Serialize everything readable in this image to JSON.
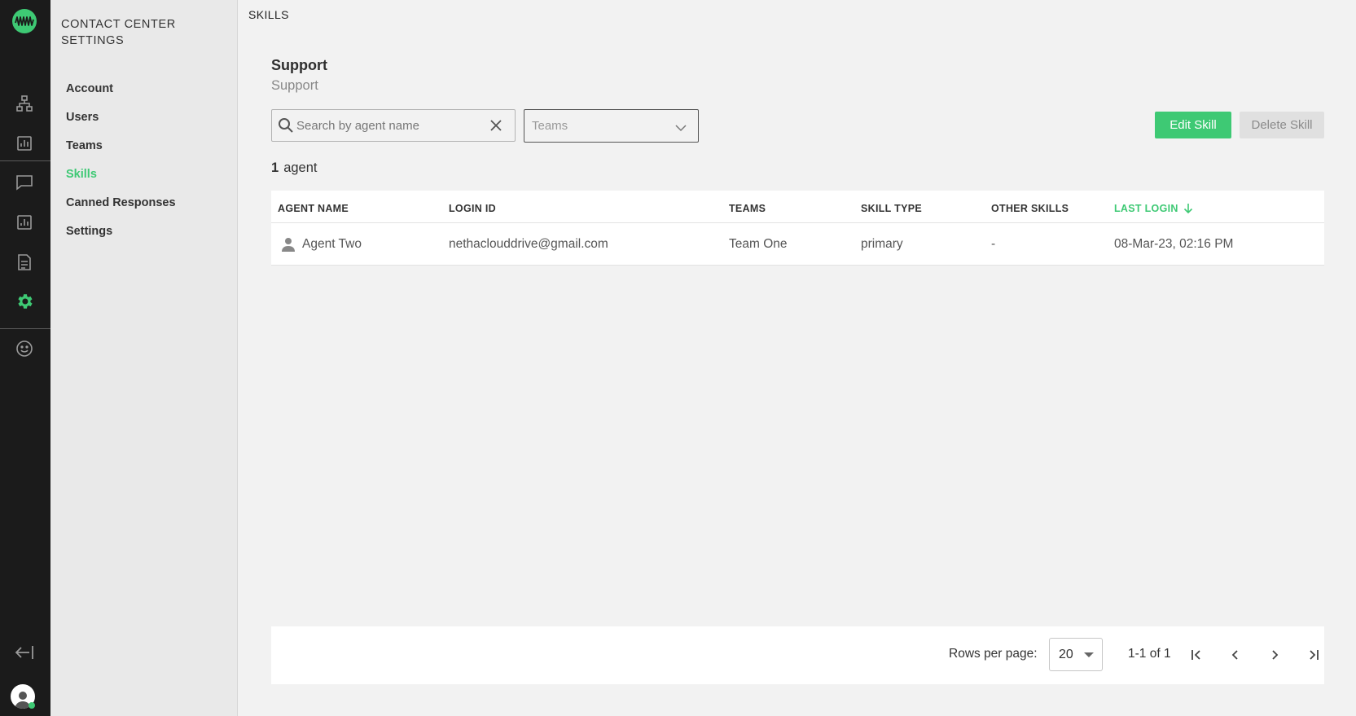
{
  "nav_rail": {
    "icons": [
      "logo-icon",
      "org-chart-icon",
      "analytics-icon",
      "chat-icon",
      "reports-icon",
      "document-icon",
      "settings-icon",
      "smiley-icon",
      "logout-icon",
      "user-avatar-icon"
    ],
    "active": "settings-icon"
  },
  "sidebar": {
    "title": "CONTACT CENTER SETTINGS",
    "items": [
      {
        "label": "Account"
      },
      {
        "label": "Users"
      },
      {
        "label": "Teams"
      },
      {
        "label": "Skills",
        "active": true
      },
      {
        "label": "Canned Responses"
      },
      {
        "label": "Settings"
      }
    ]
  },
  "breadcrumb": "SKILLS",
  "skill": {
    "name": "Support",
    "description": "Support"
  },
  "search": {
    "placeholder": "Search by agent name",
    "value": ""
  },
  "teams_filter": {
    "placeholder": "Teams"
  },
  "actions": {
    "edit_label": "Edit Skill",
    "delete_label": "Delete Skill"
  },
  "agent_count": {
    "number": "1",
    "label": "agent"
  },
  "table": {
    "columns": [
      "AGENT NAME",
      "LOGIN ID",
      "TEAMS",
      "SKILL TYPE",
      "OTHER SKILLS",
      "LAST LOGIN"
    ],
    "sorted_column": "LAST LOGIN",
    "sort_direction": "descending",
    "rows": [
      {
        "agent_name": "Agent Two",
        "login_id": "nethaclouddrive@gmail.com",
        "teams": "Team One",
        "skill_type": "primary",
        "other_skills": "-",
        "last_login": "08-Mar-23, 02:16 PM"
      }
    ]
  },
  "pagination": {
    "rows_per_page_label": "Rows per page:",
    "rows_per_page": "20",
    "range": "1-1 of 1"
  },
  "colors": {
    "accent": "#3ec974",
    "rail_bg": "#1b1b1b",
    "sidebar_bg": "#e9e9e9",
    "page_bg": "#f2f2f2"
  }
}
